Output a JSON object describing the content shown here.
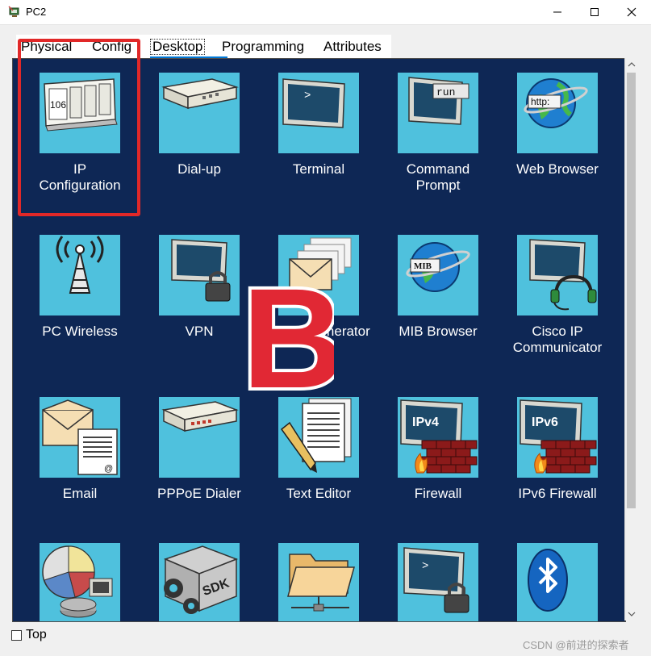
{
  "window": {
    "title": "PC2",
    "controls": {
      "minimize": "–",
      "maximize": "☐",
      "close": "✕"
    }
  },
  "tabs": [
    {
      "label": "Physical",
      "active": false
    },
    {
      "label": "Config",
      "active": false
    },
    {
      "label": "Desktop",
      "active": true
    },
    {
      "label": "Programming",
      "active": false
    },
    {
      "label": "Attributes",
      "active": false
    }
  ],
  "desktop": {
    "apps": [
      {
        "label": "IP\nConfiguration",
        "icon": "ip-config-icon"
      },
      {
        "label": "Dial-up",
        "icon": "modem-icon"
      },
      {
        "label": "Terminal",
        "icon": "terminal-icon"
      },
      {
        "label": "Command\nPrompt",
        "icon": "command-prompt-icon"
      },
      {
        "label": "Web Browser",
        "icon": "web-browser-icon"
      },
      {
        "label": "PC Wireless",
        "icon": "wireless-tower-icon"
      },
      {
        "label": "VPN",
        "icon": "vpn-lock-icon"
      },
      {
        "label": "Traffic Generator",
        "icon": "envelopes-icon"
      },
      {
        "label": "MIB Browser",
        "icon": "mib-browser-icon"
      },
      {
        "label": "Cisco IP\nCommunicator",
        "icon": "headset-icon"
      },
      {
        "label": "Email",
        "icon": "email-icon"
      },
      {
        "label": "PPPoE Dialer",
        "icon": "pppoe-modem-icon"
      },
      {
        "label": "Text Editor",
        "icon": "text-editor-icon"
      },
      {
        "label": "Firewall",
        "icon": "firewall-ipv4-icon"
      },
      {
        "label": "IPv6 Firewall",
        "icon": "firewall-ipv6-icon"
      },
      {
        "label": "",
        "icon": "netflow-chart-icon"
      },
      {
        "label": "",
        "icon": "sdk-gear-icon"
      },
      {
        "label": "",
        "icon": "folder-network-icon"
      },
      {
        "label": "",
        "icon": "ssh-terminal-lock-icon"
      },
      {
        "label": "",
        "icon": "bluetooth-icon"
      }
    ],
    "icon_text": {
      "ip_number": "106",
      "run": "run",
      "http": "http:",
      "mib": "MIB",
      "ipv4": "IPv4",
      "ipv6": "IPv6",
      "sdk": "SDK",
      "prompt": ">"
    }
  },
  "overlay": {
    "letter": "B"
  },
  "footer": {
    "top_label": "Top",
    "watermark": "CSDN @前进的探索者"
  },
  "colors": {
    "panel_bg": "#0e2755",
    "tile_bg": "#4fc1dd",
    "highlight": "#e12828",
    "tab_accent": "#0078d7"
  }
}
